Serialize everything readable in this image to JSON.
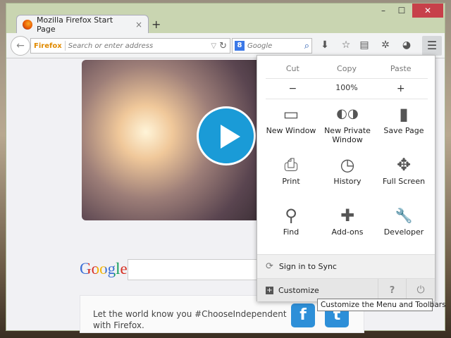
{
  "window": {
    "minimize": "–",
    "maximize": "☐",
    "close": "✕"
  },
  "tab": {
    "title": "Mozilla Firefox Start Page",
    "close": "×",
    "new_tab": "+"
  },
  "toolbar": {
    "back": "←",
    "identity": "Firefox",
    "url_placeholder": "Search or enter address",
    "dropmarker": "▽",
    "reload": "↻",
    "search_engine": "8",
    "search_placeholder": "Google",
    "search_icon": "⌕"
  },
  "content": {
    "google": "Google",
    "share_text": "Let the world know you #ChooseIndependent",
    "share_text2": "with Firefox.",
    "facebook": "f",
    "twitter": "t"
  },
  "menu": {
    "edit": {
      "cut": "Cut",
      "copy": "Copy",
      "paste": "Paste"
    },
    "zoom": {
      "out": "−",
      "level": "100%",
      "in": "+"
    },
    "items": [
      {
        "label": "New Window",
        "icon": "▭"
      },
      {
        "label": "New Private Window",
        "icon": "◐◑"
      },
      {
        "label": "Save Page",
        "icon": "▮"
      },
      {
        "label": "Print",
        "icon": "⎙"
      },
      {
        "label": "History",
        "icon": "◷"
      },
      {
        "label": "Full Screen",
        "icon": "✥"
      },
      {
        "label": "Find",
        "icon": "⚲"
      },
      {
        "label": "Add-ons",
        "icon": "✚"
      },
      {
        "label": "Developer",
        "icon": "🔧"
      }
    ],
    "sync": "Sign in to Sync",
    "customize": "Customize",
    "help": "?",
    "quit": "⏻"
  },
  "tooltip": "Customize the Menu and Toolbars",
  "colors": {
    "accent": "#1a9bd7",
    "close": "#c7404a",
    "frame": "#c9d5b1"
  }
}
